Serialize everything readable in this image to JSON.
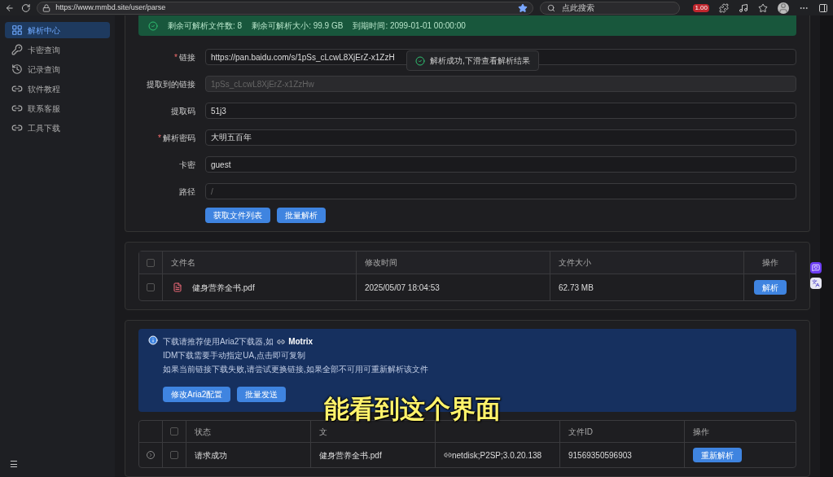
{
  "browser": {
    "url": "https://www.mmbd.site/user/parse",
    "search_placeholder": "点此搜索",
    "badge": "1.00"
  },
  "sidebar": {
    "items": [
      {
        "label": "解析中心",
        "selected": true
      },
      {
        "label": "卡密查询",
        "selected": false
      },
      {
        "label": "记录查询",
        "selected": false
      },
      {
        "label": "软件教程",
        "selected": false
      },
      {
        "label": "联系客服",
        "selected": false
      },
      {
        "label": "工具下载",
        "selected": false
      }
    ],
    "menu_glyph": "☰"
  },
  "alert": {
    "items": [
      "剩余可解析文件数: 8",
      "剩余可解析大小: 99.9 GB",
      "到期时间: 2099-01-01 00:00:00"
    ]
  },
  "toast": {
    "text": "解析成功,下滑查看解析结果"
  },
  "form": {
    "fields": [
      {
        "label": "链接",
        "required_mark": "*",
        "value": "https://pan.baidu.com/s/1pSs_cLcwL8XjErZ-x1ZzH",
        "disabled": false
      },
      {
        "label": "提取到的链接",
        "value": "1pSs_cLcwL8XjErZ-x1ZzHw",
        "disabled": true
      },
      {
        "label": "提取码",
        "value": "51j3",
        "disabled": false
      },
      {
        "label": "解析密码",
        "required_mark": "*",
        "value": "大明五百年",
        "disabled": false
      },
      {
        "label": "卡密",
        "value": "guest",
        "disabled": false
      },
      {
        "label": "路径",
        "placeholder": "/",
        "disabled": false
      }
    ],
    "buttons": [
      "获取文件列表",
      "批量解析"
    ]
  },
  "files": {
    "header_checked": false,
    "columns": [
      "文件名",
      "修改时间",
      "文件大小",
      "操作"
    ],
    "rows": [
      {
        "checked": false,
        "name": "健身营养全书.pdf",
        "time": "2025/05/07 18:04:53",
        "size": "62.73 MB",
        "action": "解析"
      }
    ]
  },
  "info": {
    "line1": "下载请推荐使用Aria2下载器,如",
    "link": "Motrix",
    "lines": [
      "IDM下载需要手动指定UA,点击即可复制",
      "如果当前链接下载失败,请尝试更换链接,如果全部不可用可重新解析该文件"
    ],
    "buttons": [
      "修改Aria2配置",
      "批量发送"
    ]
  },
  "results": {
    "header_checked": false,
    "columns": [
      "状态",
      "文",
      "文件ID",
      "操作"
    ],
    "rows": [
      {
        "checked": false,
        "status": "请求成功",
        "name": "健身营养全书.pdf",
        "ua": "netdisk;P2SP;3.0.20.138",
        "id": "91569350596903",
        "action": "重新解析"
      }
    ]
  },
  "subtitle": "能看到这个界面"
}
